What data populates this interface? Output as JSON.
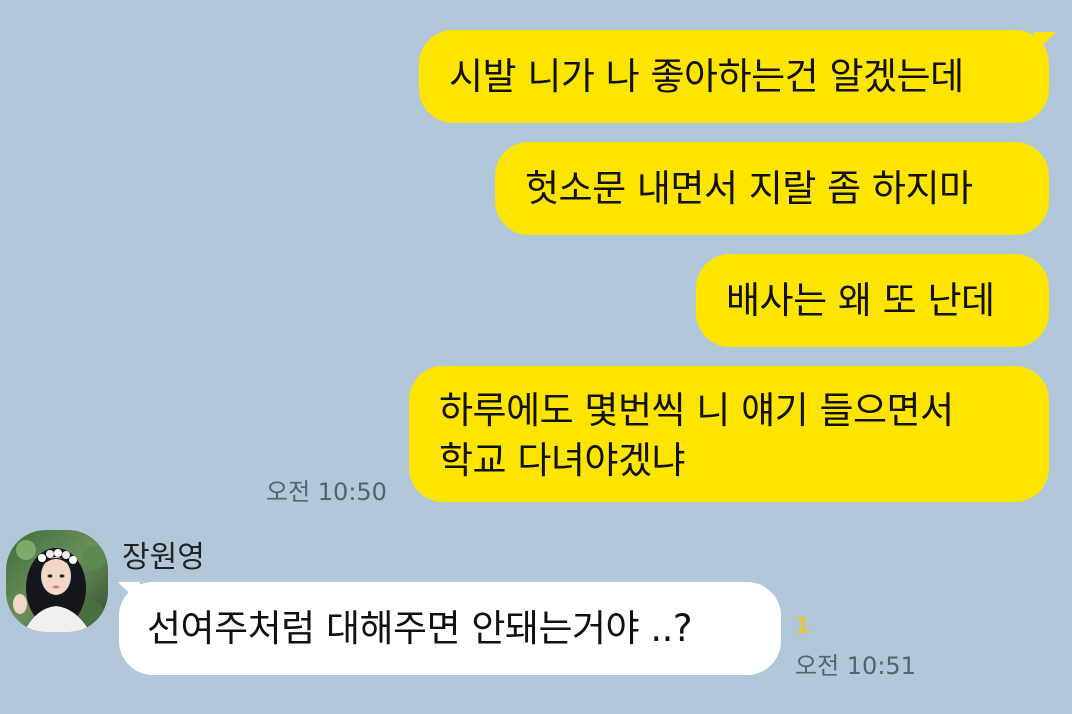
{
  "messages_out": [
    {
      "text": "시발 니가 나 좋아하는건 알겠는데"
    },
    {
      "text": "헛소문 내면서 지랄 좀 하지마"
    },
    {
      "text": "배사는 왜 또 난데"
    },
    {
      "lines": [
        "하루에도 몇번씩 니 얘기 들으면서",
        "학교 다녀야겠냐"
      ],
      "time": "오전 10:50"
    }
  ],
  "message_in": {
    "sender": "장원영",
    "text": "선여주처럼 대해주면 안돼는거야 ..?",
    "unread_count": "1",
    "time": "오전 10:51"
  },
  "colors": {
    "background": "#b2c7da",
    "outgoing_bubble": "#fee500",
    "incoming_bubble": "#ffffff",
    "unread": "#e9c43a"
  }
}
